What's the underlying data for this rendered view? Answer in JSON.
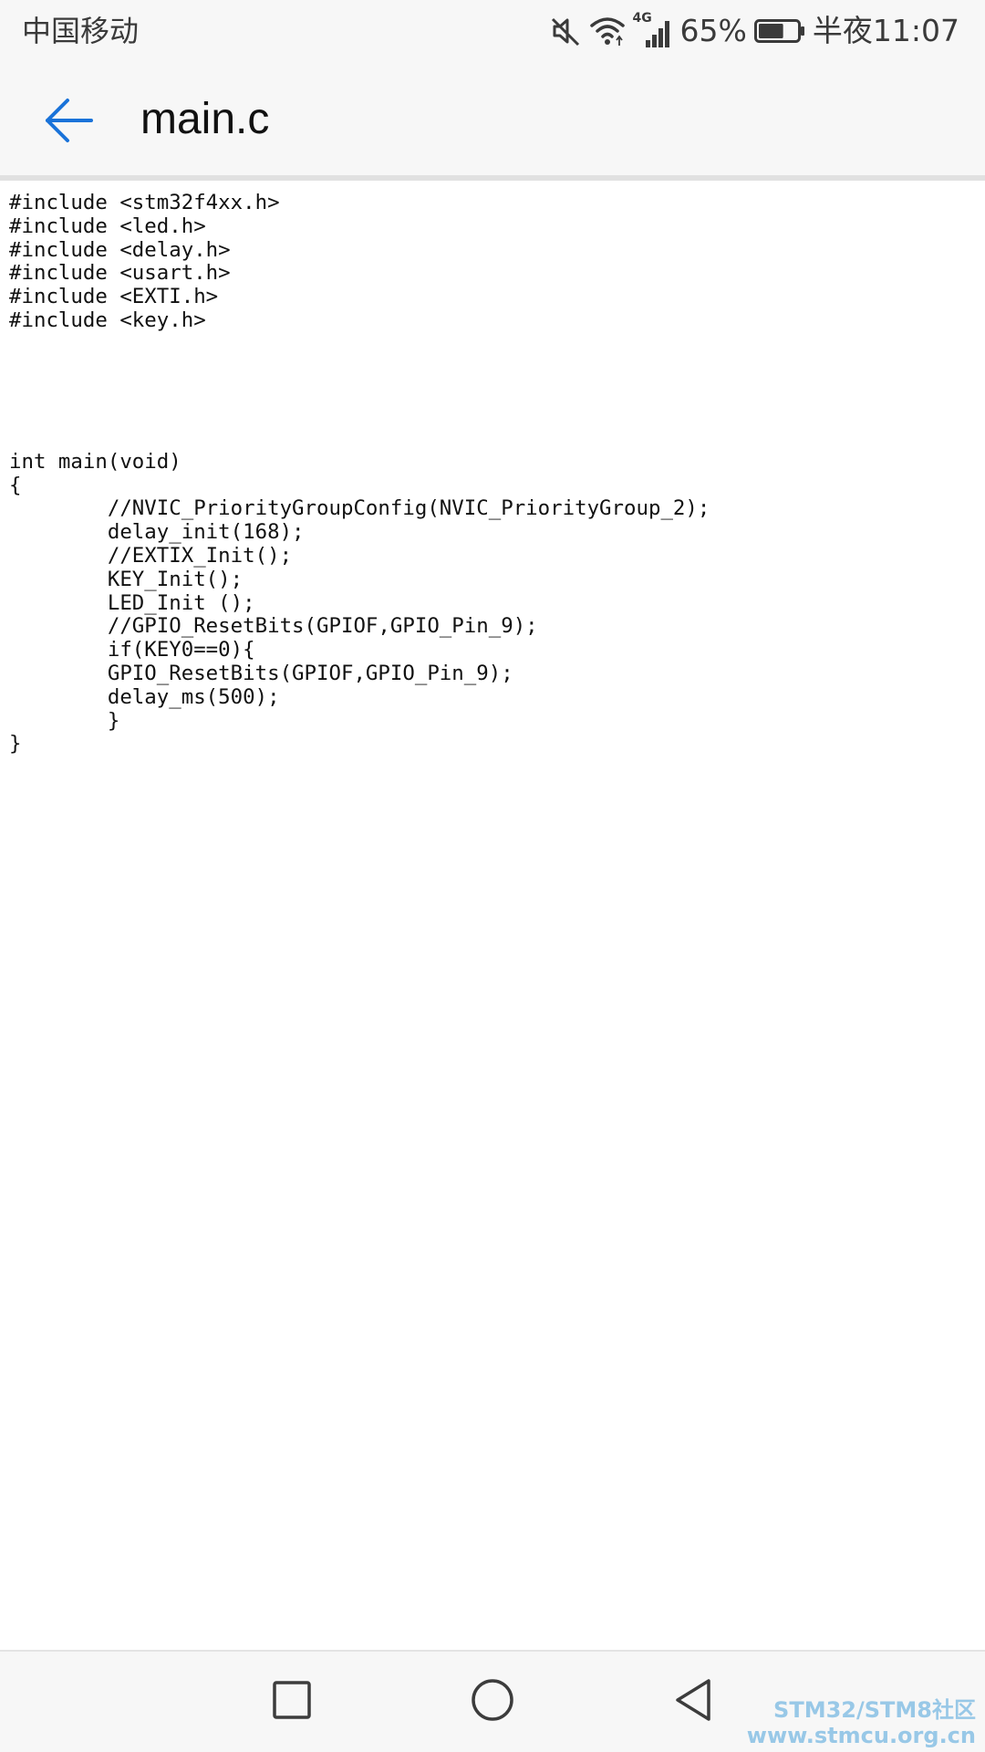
{
  "status_bar": {
    "carrier": "中国移动",
    "network_label": "4G",
    "battery_percent": "65%",
    "battery_level": 0.65,
    "time": "半夜11:07",
    "icons": [
      "mute-icon",
      "wifi-icon",
      "signal-icon",
      "battery-icon"
    ]
  },
  "app_bar": {
    "title": "main.c",
    "back_icon": "arrow-left-icon",
    "accent_color": "#1a73d9"
  },
  "code": {
    "lines": [
      "#include <stm32f4xx.h>",
      "#include <led.h>",
      "#include <delay.h>",
      "#include <usart.h>",
      "#include <EXTI.h>",
      "#include <key.h>",
      "",
      "",
      "",
      "",
      "",
      "int main(void)",
      "{",
      "        //NVIC_PriorityGroupConfig(NVIC_PriorityGroup_2);",
      "        delay_init(168);",
      "        //EXTIX_Init();",
      "        KEY_Init();",
      "        LED_Init ();",
      "        //GPIO_ResetBits(GPIOF,GPIO_Pin_9);",
      "        if(KEY0==0){",
      "        GPIO_ResetBits(GPIOF,GPIO_Pin_9);",
      "        delay_ms(500);",
      "        }",
      "}"
    ]
  },
  "nav_bar": {
    "buttons": [
      "recents-square-icon",
      "home-circle-icon",
      "back-triangle-icon"
    ]
  },
  "watermark": {
    "line1": "STM32/STM8社区",
    "line2": "www.stmcu.org.cn",
    "color": "#8ec3e6"
  }
}
